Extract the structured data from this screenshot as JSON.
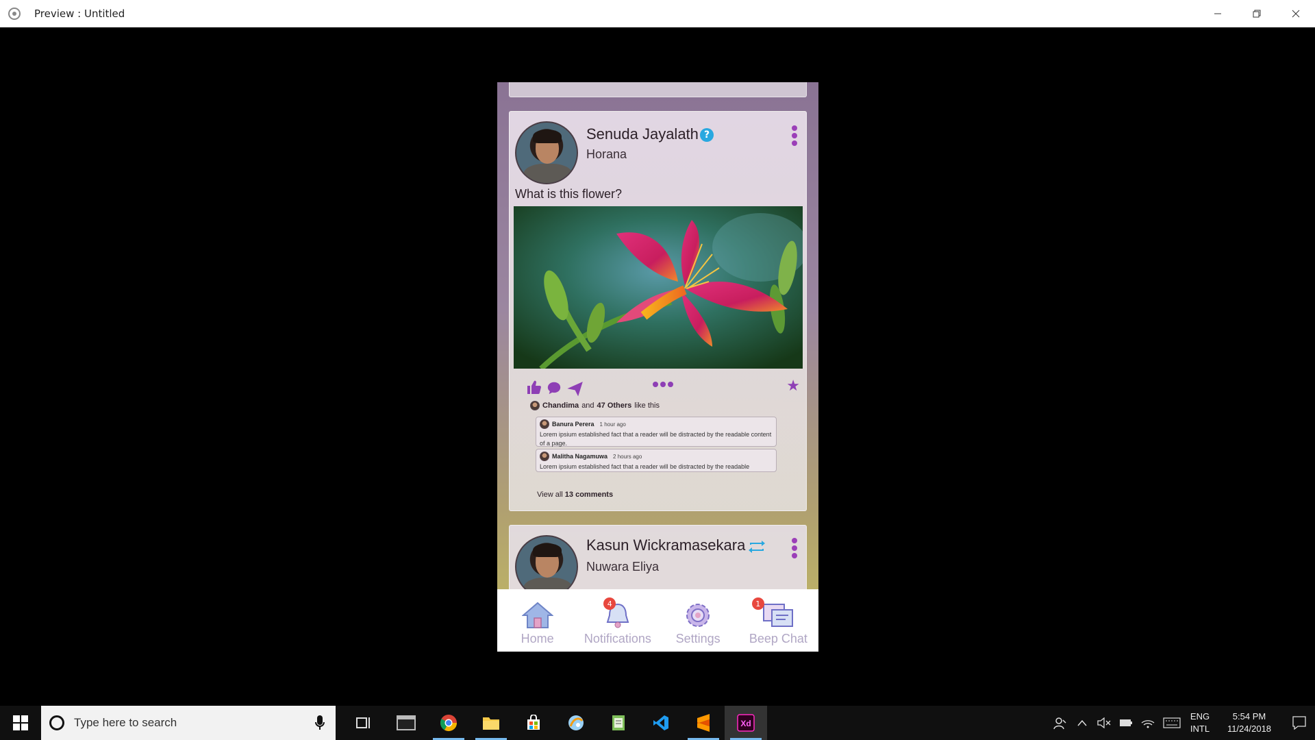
{
  "window": {
    "title": "Preview : Untitled",
    "minimize_icon": "minimize-icon",
    "maximize_icon": "restore-icon",
    "close_icon": "close-icon"
  },
  "feed": {
    "posts": [
      {
        "author": "Senuda Jayalath",
        "badge": "verified-icon",
        "badge_glyph": "?",
        "location": "Horana",
        "text": "What is this flower?",
        "image": "flower-photo",
        "likes": {
          "first_name": "Chandima",
          "and": "and",
          "others": "47 Others",
          "suffix": "like this"
        },
        "comments": [
          {
            "author": "Banura Perera",
            "time": "1 hour ago",
            "text": "Lorem ipsium established fact that a reader will be distracted by the readable content of a page."
          },
          {
            "author": "Malitha Nagamuwa",
            "time": "2 hours ago",
            "text": "Lorem ipsium established fact that a reader will be distracted by the readable"
          }
        ],
        "view_all_prefix": "View all",
        "view_all_count": "13 comments"
      },
      {
        "author": "Kasun Wickramasekara",
        "badge": "repost-icon",
        "location": "Nuwara Eliya"
      }
    ]
  },
  "bottom_nav": {
    "items": [
      {
        "label": "Home",
        "icon": "home-icon"
      },
      {
        "label": "Notifications",
        "icon": "bell-icon",
        "badge": "4"
      },
      {
        "label": "Settings",
        "icon": "gear-icon"
      },
      {
        "label": "Beep Chat",
        "icon": "chat-icon",
        "badge": "1"
      }
    ]
  },
  "taskbar": {
    "search_placeholder": "Type here to search",
    "apps": [
      "task-view-icon",
      "terminal-icon",
      "chrome-icon",
      "file-explorer-icon",
      "store-icon",
      "pinball-icon",
      "notepad-icon",
      "vscode-icon",
      "sublime-icon",
      "adobe-xd-icon"
    ],
    "lang_line1": "ENG",
    "lang_line2": "INTL",
    "time": "5:54 PM",
    "date": "11/24/2018"
  },
  "colors": {
    "accent": "#8e3fb5",
    "verified": "#29a8e0",
    "badge": "#e8473e",
    "nav_label": "#b0a6c4"
  }
}
